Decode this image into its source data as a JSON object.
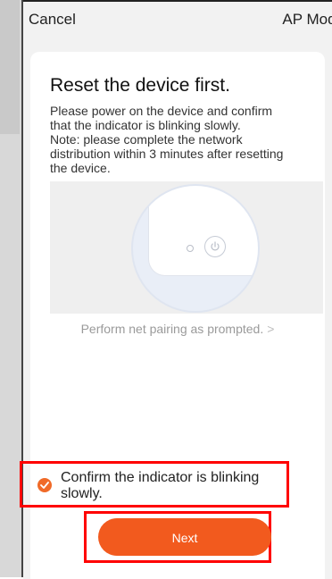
{
  "nav": {
    "cancel_label": "Cancel",
    "title": "AP Mode"
  },
  "content": {
    "heading": "Reset the device first.",
    "description_lines": [
      "Please power on the device and confirm",
      "that the indicator is blinking slowly.",
      "Note: please complete the network",
      "distribution within 3 minutes after resetting",
      "the device."
    ],
    "pairing_link": "Perform net pairing as prompted.",
    "pairing_link_chevron": ">"
  },
  "confirm": {
    "checked": true,
    "label": "Confirm the indicator is blinking slowly."
  },
  "actions": {
    "next_label": "Next"
  },
  "colors": {
    "accent": "#f25a1e",
    "highlight": "#ff0000",
    "screen_bg": "#f2f2f2"
  },
  "icons": {
    "power": "power-icon",
    "led": "indicator-led-icon",
    "check": "checkmark-icon"
  }
}
